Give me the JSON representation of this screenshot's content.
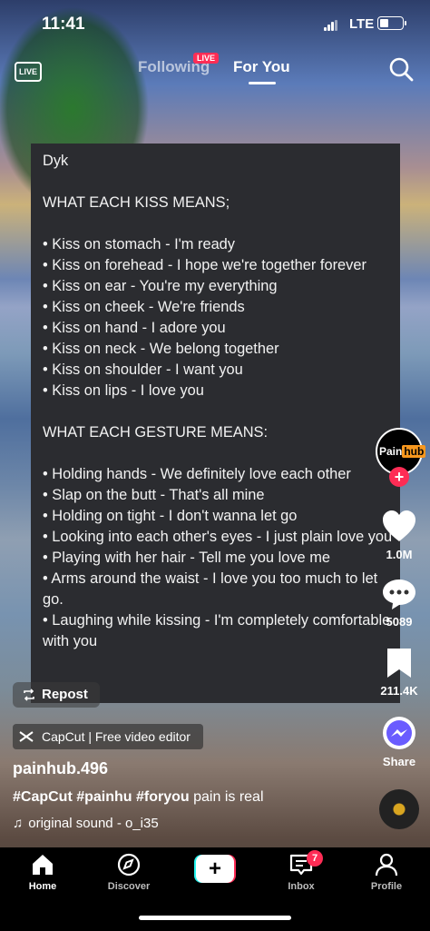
{
  "status_bar": {
    "time": "11:41",
    "network": "LTE"
  },
  "top_nav": {
    "live_label": "LIVE",
    "following_label": "Following",
    "live_badge": "LIVE",
    "for_you_label": "For You"
  },
  "card": {
    "lines": [
      "Dyk",
      "",
      "WHAT EACH KISS MEANS;",
      "",
      "• Kiss on stomach - I'm ready",
      "• Kiss on forehead - I hope we're together forever",
      "• Kiss on ear - You're my everything",
      "• Kiss on cheek - We're friends",
      "• Kiss on hand - I adore you",
      "• Kiss on neck - We belong together",
      "• Kiss on shoulder - I want you",
      "• Kiss on lips - I love you",
      "",
      "WHAT EACH GESTURE MEANS:",
      "",
      "• Holding hands - We definitely love each other",
      "• Slap on the butt - That's all mine",
      "• Holding on tight - I don't wanna let go",
      "• Looking into each other's eyes - I just plain love you",
      "• Playing with her hair - Tell me you love me",
      "• Arms around the waist - I love you too much to let go.",
      "• Laughing while kissing - I'm completely comfortable with you"
    ]
  },
  "rail": {
    "avatar_logo_left": "Pain",
    "avatar_logo_right": "hub",
    "likes": "1.0M",
    "comments": "5089",
    "saves": "211.4K",
    "share_label": "Share"
  },
  "video_info": {
    "repost_label": "Repost",
    "capcut_label": "CapCut | Free video editor",
    "username": "painhub.496",
    "hashtags": "#CapCut #painhu #foryou",
    "caption_rest": " pain is real",
    "sound": "original sound - o_i35"
  },
  "bottom_nav": {
    "home": "Home",
    "discover": "Discover",
    "inbox": "Inbox",
    "inbox_badge": "7",
    "profile": "Profile"
  },
  "colors": {
    "accent": "#fe2c55",
    "teal": "#25f4ee",
    "card_bg": "#2b2c30"
  }
}
